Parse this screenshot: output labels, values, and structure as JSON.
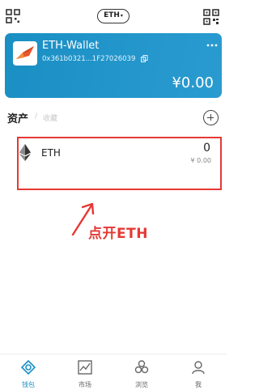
{
  "header": {
    "network": "ETH"
  },
  "wallet": {
    "name": "ETH-Wallet",
    "address": "0x361b0321...1F27026039",
    "balance": "¥0.00"
  },
  "tabs": {
    "assets": "资产",
    "separator": "/",
    "collectibles": "收藏"
  },
  "assets": [
    {
      "symbol": "ETH",
      "amount": "0",
      "value": "¥ 0.00"
    }
  ],
  "annotation": {
    "text": "点开ETH"
  },
  "nav": [
    {
      "label": "钱包",
      "icon": "wallet-icon",
      "active": true
    },
    {
      "label": "市场",
      "icon": "market-chart-icon",
      "active": false
    },
    {
      "label": "浏览",
      "icon": "browse-icon",
      "active": false
    },
    {
      "label": "我",
      "icon": "profile-icon",
      "active": false
    }
  ],
  "colors": {
    "accent": "#1a8fc4",
    "annotation": "#e53935"
  }
}
